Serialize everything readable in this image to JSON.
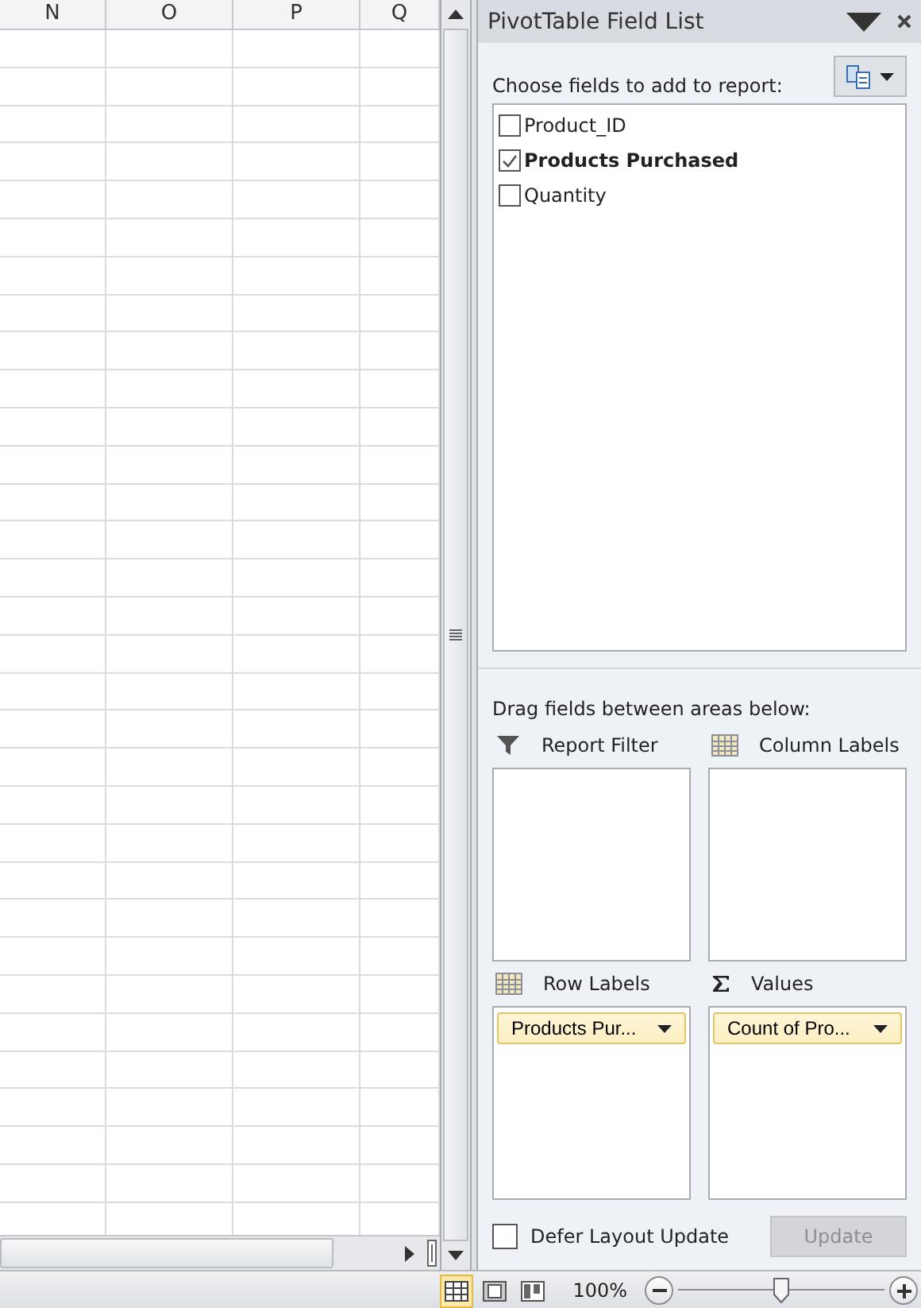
{
  "sheet": {
    "columns": [
      "N",
      "O",
      "P",
      "Q"
    ]
  },
  "field_list": {
    "title": "PivotTable Field List",
    "prompt": "Choose fields to add to report:",
    "fields": [
      {
        "name": "Product_ID",
        "checked": false
      },
      {
        "name": "Products Purchased",
        "checked": true
      },
      {
        "name": "Quantity",
        "checked": false
      }
    ],
    "areas_prompt": "Drag fields between areas below:",
    "areas": [
      {
        "kind": "filter",
        "label": "Report Filter"
      },
      {
        "kind": "columns",
        "label": "Column Labels"
      },
      {
        "kind": "rows",
        "label": "Row Labels",
        "items": [
          "Products Pur..."
        ]
      },
      {
        "kind": "values",
        "label": "Values",
        "items": [
          "Count of Pro..."
        ]
      }
    ],
    "defer_update": {
      "label": "Defer Layout Update",
      "checked": false
    },
    "update_button": {
      "label": "Update",
      "disabled": true
    }
  },
  "status_bar": {
    "views": [
      {
        "kind": "normal",
        "selected": true
      },
      {
        "kind": "layout",
        "selected": false
      },
      {
        "kind": "pagebreak",
        "selected": false
      }
    ],
    "zoom": "100%",
    "zoom_slider": {
      "level": 0.5
    }
  }
}
